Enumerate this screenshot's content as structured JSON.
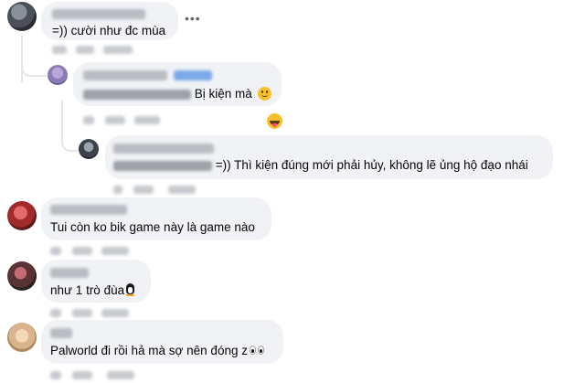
{
  "comments": [
    {
      "id": "c1",
      "text": "=)) cười như đc mùa",
      "more_icon": "more-dots-icon"
    },
    {
      "id": "r1",
      "text": "Bị kiện mà",
      "emoji": "smiling-face-emoji",
      "reaction": "tongue-out-emoji"
    },
    {
      "id": "r2",
      "text": "=)) Thì kiện đúng mới phải hủy, không lẽ ủng hộ đạo nhái"
    },
    {
      "id": "c2",
      "text": "Tui còn ko bik game này là game nào"
    },
    {
      "id": "c3",
      "text": "như 1 trò đùa",
      "emoji": "penguin-emoji"
    },
    {
      "id": "c4",
      "text": "Palworld đi rồi hả mà sợ nên đóng z",
      "emoji": "eyes-emoji"
    }
  ],
  "more_label": "•••"
}
